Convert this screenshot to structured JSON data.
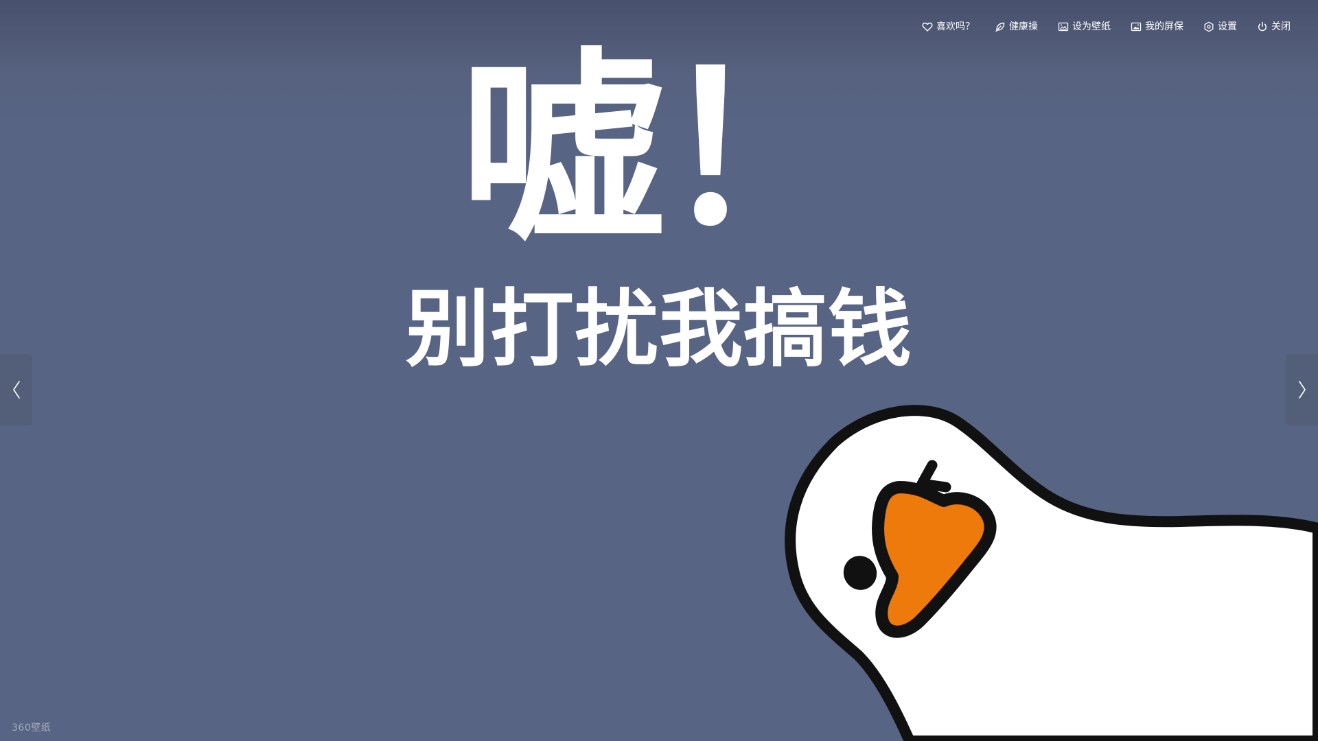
{
  "headline": "嘘！",
  "subheadline": "别打扰我搞钱",
  "toolbar": {
    "items": [
      {
        "label": "喜欢吗？",
        "icon": "heart-icon"
      },
      {
        "label": "健康操",
        "icon": "leaf-icon"
      },
      {
        "label": "设为壁纸",
        "icon": "wallpaper-icon"
      },
      {
        "label": "我的屏保",
        "icon": "image-icon"
      },
      {
        "label": "设置",
        "icon": "gear-icon"
      },
      {
        "label": "关闭",
        "icon": "power-icon"
      }
    ]
  },
  "navigation": {
    "prev_icon": "chevron-left-icon",
    "next_icon": "chevron-right-icon"
  },
  "watermark": "360壁纸",
  "colors": {
    "background": "#576484",
    "goose_beak": "#ee7a0c",
    "goose_body": "#ffffff",
    "outline": "#111111"
  }
}
